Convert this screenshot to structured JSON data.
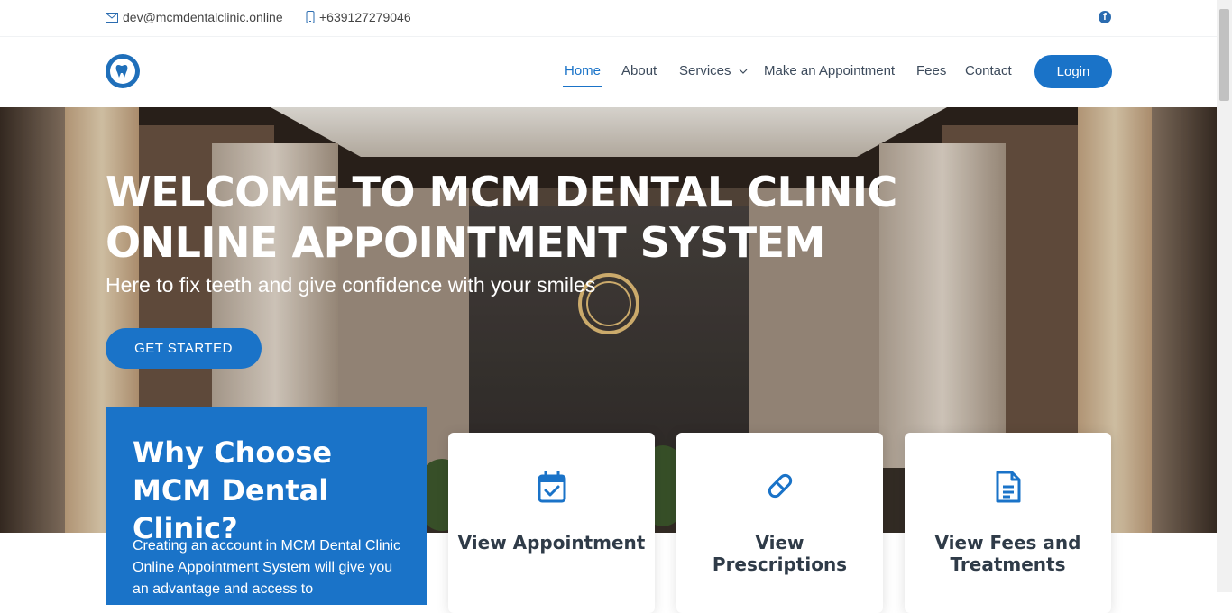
{
  "topbar": {
    "email": "dev@mcmdentalclinic.online",
    "phone": "+639127279046"
  },
  "nav": {
    "items": [
      "Home",
      "About",
      "Services",
      "Make an Appointment",
      "Fees",
      "Contact"
    ],
    "active": "Home",
    "login_label": "Login"
  },
  "hero": {
    "title": "WELCOME TO MCM DENTAL CLINIC ONLINE APPOINTMENT SYSTEM",
    "subtitle": "Here to fix teeth and give confidence with your smiles",
    "cta_label": "GET STARTED"
  },
  "why": {
    "title": "Why Choose MCM Dental Clinic?",
    "text": "Creating an account in MCM Dental Clinic Online Appointment System will give you an advantage and access to"
  },
  "cards": [
    {
      "title": "View Appointment",
      "icon": "calendar-check-icon"
    },
    {
      "title": "View Prescriptions",
      "icon": "pill-icon"
    },
    {
      "title": "View Fees and Treatments",
      "icon": "document-icon"
    }
  ],
  "colors": {
    "accent": "#1a73c8"
  }
}
